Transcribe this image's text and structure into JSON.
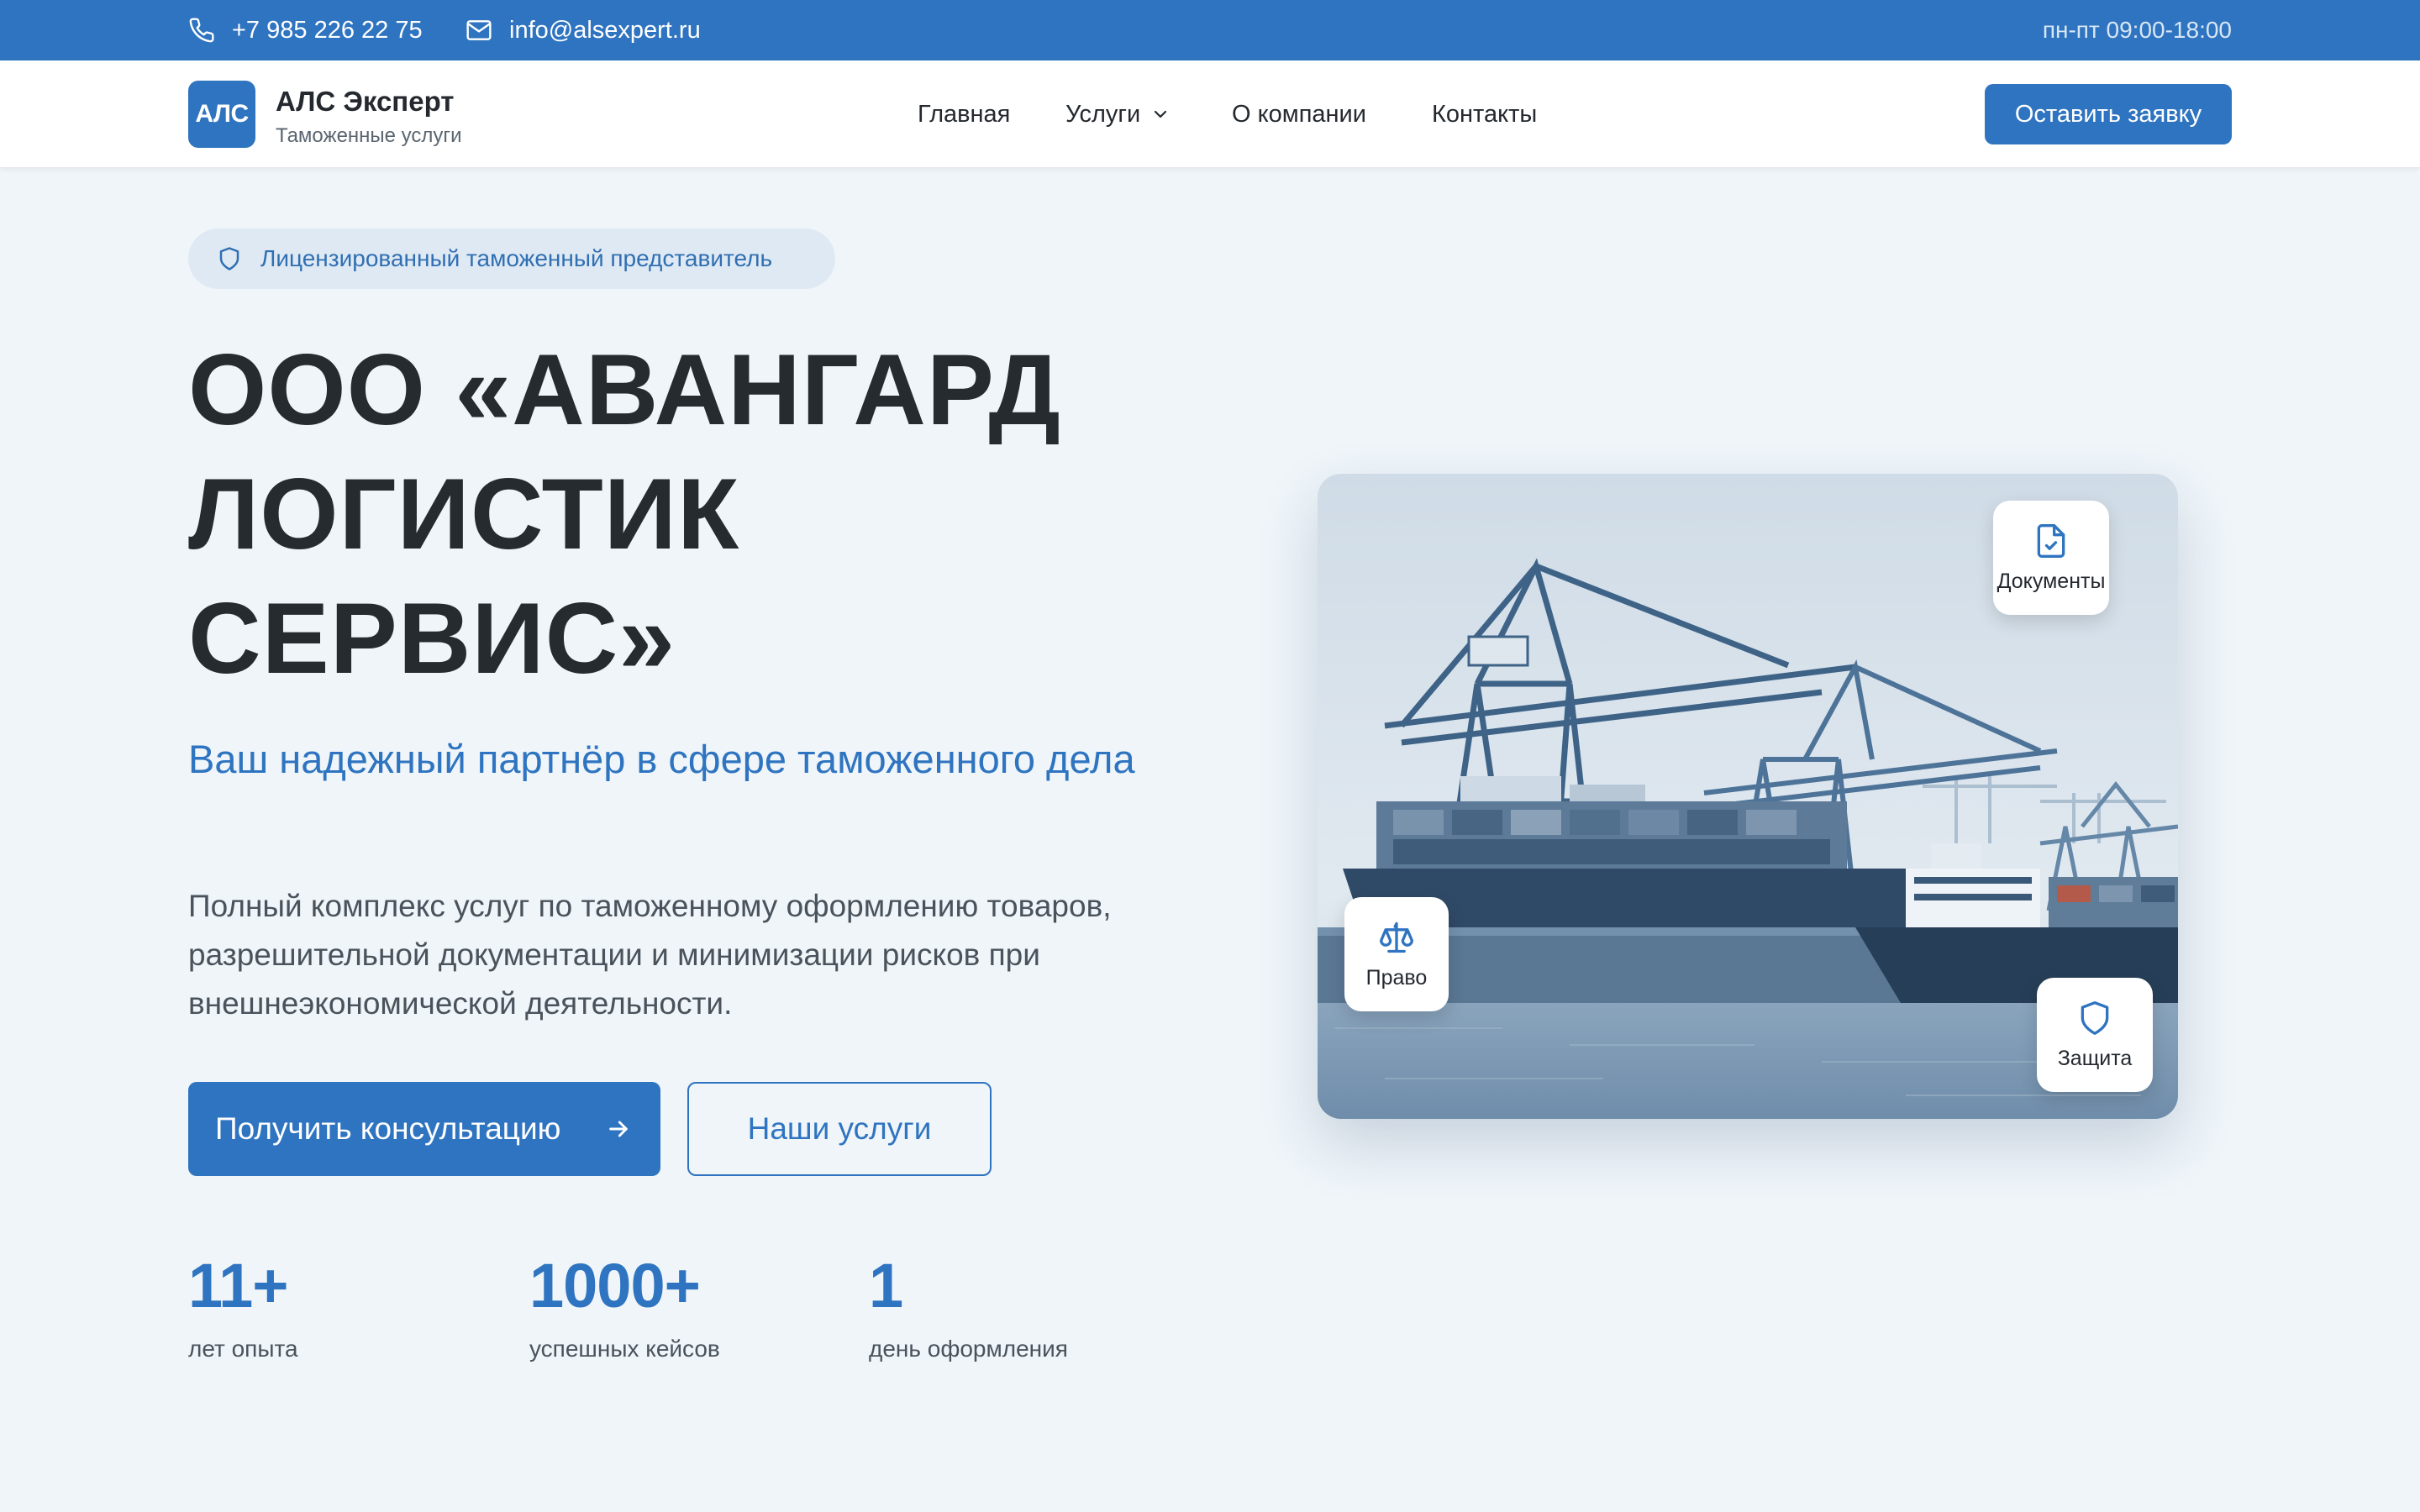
{
  "topbar": {
    "phone": "+7 985 226 22 75",
    "email": "info@alsexpert.ru",
    "hours": "пн-пт 09:00-18:00"
  },
  "brand": {
    "logo_text": "АЛС",
    "name": "АЛС Эксперт",
    "tagline": "Таможенные услуги"
  },
  "nav": {
    "items": [
      "Главная",
      "Услуги",
      "О компании",
      "Контакты"
    ],
    "cta": "Оставить заявку"
  },
  "hero": {
    "badge": "Лицензированный таможенный представитель",
    "title_lines": [
      "ООО «АВАНГАРД",
      "ЛОГИСТИК",
      "СЕРВИС»"
    ],
    "subtitle": "Ваш надежный партнёр в сфере таможенного дела",
    "description": "Полный комплекс услуг по таможенному оформлению товаров, разрешительной документации и минимизации рисков при внешнеэкономической деятельности.",
    "primary_button": "Получить консультацию",
    "secondary_button": "Наши услуги"
  },
  "stats": [
    {
      "value": "11+",
      "label": "лет опыта"
    },
    {
      "value": "1000+",
      "label": "успешных кейсов"
    },
    {
      "value": "1",
      "label": "день оформления"
    }
  ],
  "image_chips": {
    "documents": "Документы",
    "law": "Право",
    "protection": "Защита"
  },
  "colors": {
    "primary": "#2f74c0",
    "background": "#eff5f9",
    "heading": "#262b30"
  }
}
